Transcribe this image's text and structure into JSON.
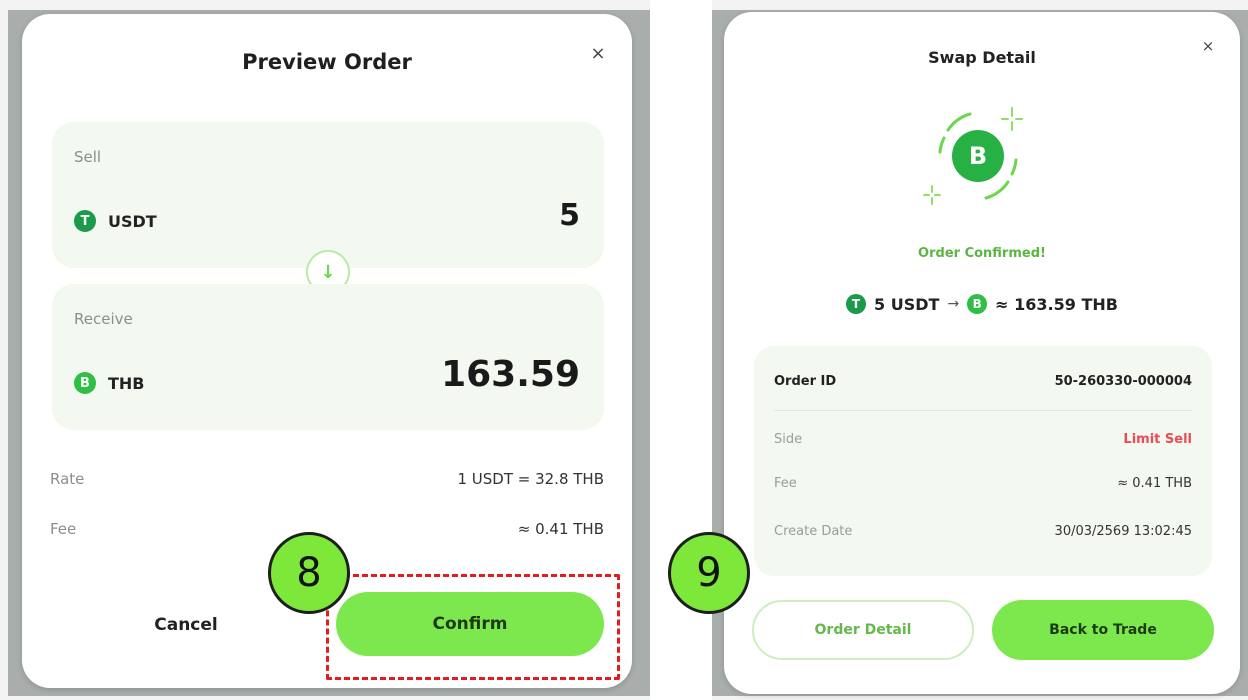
{
  "preview": {
    "title": "Preview Order",
    "close": "×",
    "sell": {
      "label": "Sell",
      "coin": "USDT",
      "coin_icon": "T",
      "amount": "5"
    },
    "receive": {
      "label": "Receive",
      "coin": "THB",
      "coin_icon": "B",
      "amount": "163.59"
    },
    "rate": {
      "label": "Rate",
      "value": "1 USDT = 32.8 THB"
    },
    "fee": {
      "label": "Fee",
      "value": "≈ 0.41 THB"
    },
    "cancel_label": "Cancel",
    "confirm_label": "Confirm"
  },
  "swap_detail": {
    "title": "Swap Detail",
    "close": "×",
    "success_icon": "B",
    "status": "Order Confirmed!",
    "summary": {
      "from_icon": "T",
      "from": "5 USDT",
      "arrow": "→",
      "to_icon": "B",
      "to": "≈ 163.59 THB"
    },
    "order_id": {
      "label": "Order ID",
      "value": "50-260330-000004"
    },
    "side": {
      "label": "Side",
      "value": "Limit Sell"
    },
    "fee": {
      "label": "Fee",
      "value": "≈ 0.41 THB"
    },
    "create_date": {
      "label": "Create Date",
      "value": "30/03/2569 13:02:45"
    },
    "order_detail_label": "Order Detail",
    "back_label": "Back to Trade"
  },
  "steps": {
    "step_8": "8",
    "step_9": "9"
  },
  "colors": {
    "accent_green": "#7de84e",
    "success_green": "#5ab542",
    "sell_red": "#ea4b55",
    "highlight_red": "#e21d1d"
  }
}
